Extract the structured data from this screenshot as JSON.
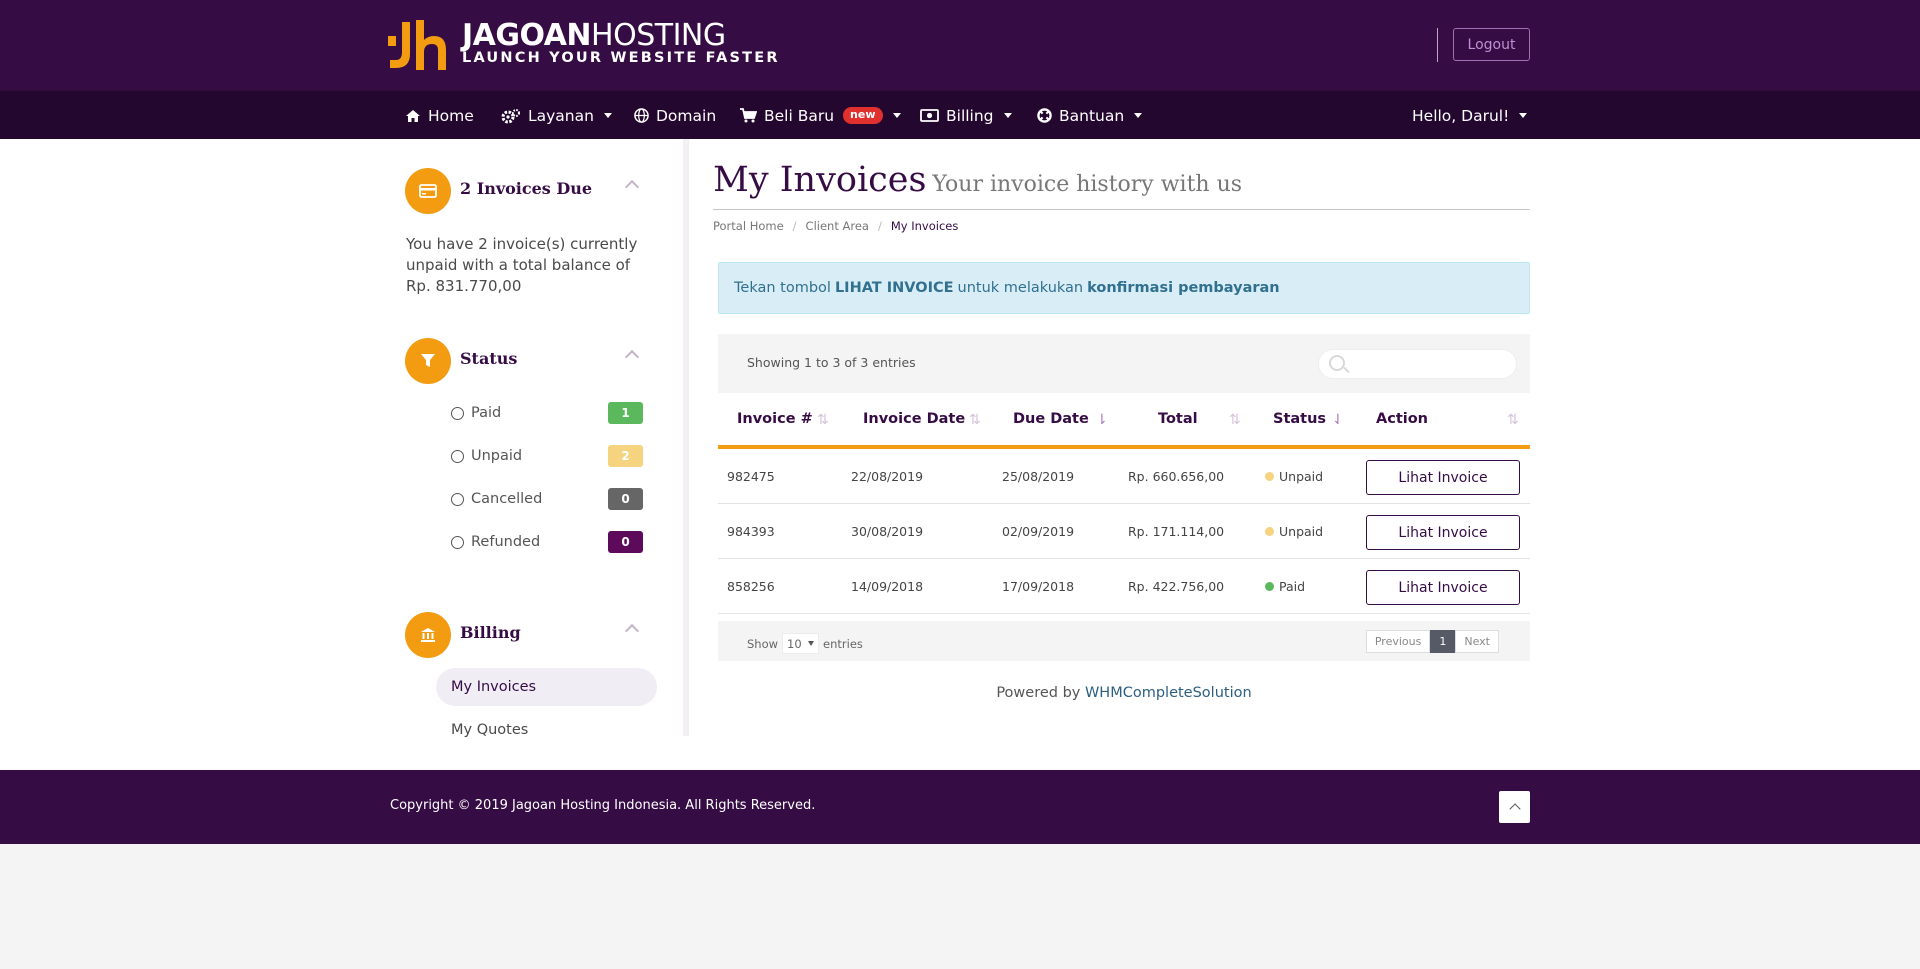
{
  "brand": {
    "name_bold": "JAGOAN",
    "name_light": "HOSTING",
    "tagline": "LAUNCH YOUR WEBSITE FASTER",
    "colors": {
      "primary": "#360c45",
      "accent": "#f39c12"
    }
  },
  "header": {
    "logout_label": "Logout"
  },
  "nav": {
    "items": [
      {
        "label": "Home",
        "icon": "home-icon"
      },
      {
        "label": "Layanan",
        "icon": "gears-icon"
      },
      {
        "label": "Domain",
        "icon": "globe-icon"
      },
      {
        "label": "Beli Baru",
        "icon": "cart-icon",
        "badge": "new"
      },
      {
        "label": "Billing",
        "icon": "money-icon"
      },
      {
        "label": "Bantuan",
        "icon": "lifebuoy-icon"
      }
    ],
    "user_menu": "Hello, Darul!"
  },
  "sidebar": {
    "due": {
      "title": "2 Invoices Due",
      "text": "You have 2 invoice(s) currently unpaid with a total balance of Rp. 831.770,00"
    },
    "status": {
      "title": "Status",
      "items": [
        {
          "label": "Paid",
          "count": "1",
          "color": "#5cb85c"
        },
        {
          "label": "Unpaid",
          "count": "2",
          "color": "#f5d37f"
        },
        {
          "label": "Cancelled",
          "count": "0",
          "color": "#666666"
        },
        {
          "label": "Refunded",
          "count": "0",
          "color": "#5e0a5b"
        }
      ]
    },
    "billing": {
      "title": "Billing",
      "items": [
        {
          "label": "My Invoices",
          "active": true
        },
        {
          "label": "My Quotes",
          "active": false
        }
      ]
    }
  },
  "main": {
    "title": "My Invoices",
    "subtitle": "Your invoice history with us",
    "breadcrumb": [
      "Portal Home",
      "Client Area",
      "My Invoices"
    ],
    "alert": {
      "pre": "Tekan tombol",
      "bold1": "LIHAT INVOICE",
      "mid": "untuk melakukan",
      "bold2": "konfirmasi pembayaran"
    },
    "showing": "Showing 1 to 3 of 3 entries",
    "search_placeholder": "",
    "columns": [
      "Invoice #",
      "Invoice Date",
      "Due Date",
      "Total",
      "Status",
      "Action"
    ],
    "rows": [
      {
        "id": "982475",
        "date": "22/08/2019",
        "due": "25/08/2019",
        "total": "Rp. 660.656,00",
        "status": "Unpaid",
        "status_color": "#f5d37f",
        "action": "Lihat Invoice"
      },
      {
        "id": "984393",
        "date": "30/08/2019",
        "due": "02/09/2019",
        "total": "Rp. 171.114,00",
        "status": "Unpaid",
        "status_color": "#f5d37f",
        "action": "Lihat Invoice"
      },
      {
        "id": "858256",
        "date": "14/09/2018",
        "due": "17/09/2018",
        "total": "Rp. 422.756,00",
        "status": "Paid",
        "status_color": "#5cb85c",
        "action": "Lihat Invoice"
      }
    ],
    "footer": {
      "show": "Show",
      "entries_value": "10",
      "entries": "entries",
      "prev": "Previous",
      "page": "1",
      "next": "Next"
    },
    "powered_pre": "Powered by",
    "powered_link": "WHMCompleteSolution"
  },
  "footer": {
    "copyright": "Copyright © 2019 Jagoan Hosting Indonesia. All Rights Reserved."
  }
}
